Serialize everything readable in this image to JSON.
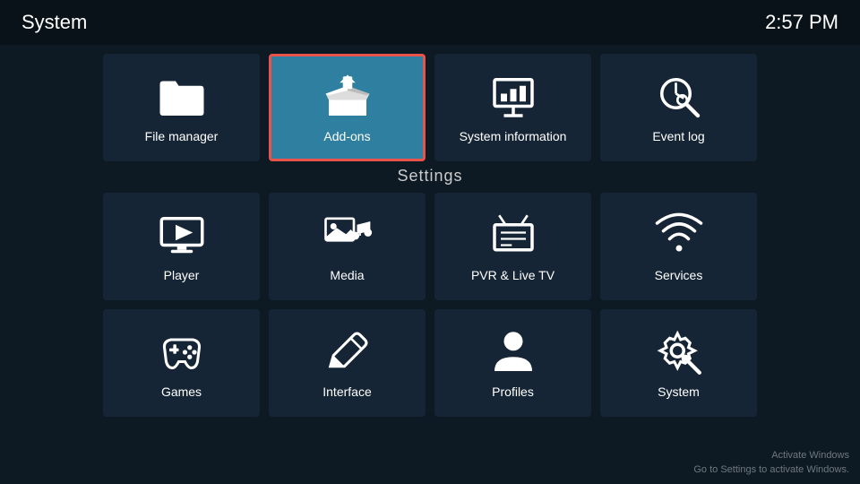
{
  "header": {
    "title": "System",
    "time": "2:57 PM"
  },
  "settings_label": "Settings",
  "top_row": [
    {
      "id": "file-manager",
      "label": "File manager"
    },
    {
      "id": "add-ons",
      "label": "Add-ons",
      "selected": true
    },
    {
      "id": "system-information",
      "label": "System information"
    },
    {
      "id": "event-log",
      "label": "Event log"
    }
  ],
  "settings_row1": [
    {
      "id": "player",
      "label": "Player"
    },
    {
      "id": "media",
      "label": "Media"
    },
    {
      "id": "pvr-live-tv",
      "label": "PVR & Live TV"
    },
    {
      "id": "services",
      "label": "Services"
    }
  ],
  "settings_row2": [
    {
      "id": "games",
      "label": "Games"
    },
    {
      "id": "interface",
      "label": "Interface"
    },
    {
      "id": "profiles",
      "label": "Profiles"
    },
    {
      "id": "system",
      "label": "System"
    }
  ],
  "watermark": {
    "line1": "Activate Windows",
    "line2": "Go to Settings to activate Windows."
  }
}
